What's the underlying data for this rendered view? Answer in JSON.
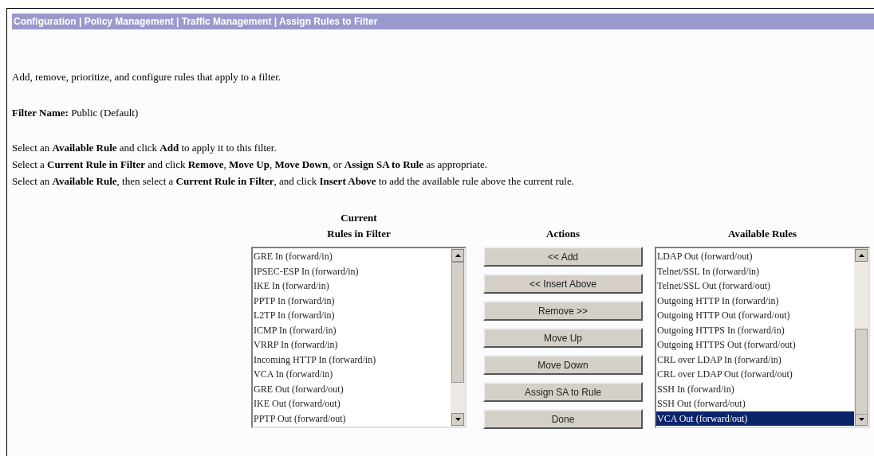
{
  "breadcrumb": "Configuration | Policy Management | Traffic Management | Assign Rules to Filter",
  "intro": "Add, remove, prioritize, and configure rules that apply to a filter.",
  "filter_name": {
    "label": "Filter Name:",
    "value": "Public (Default)"
  },
  "instructions": [
    "Select an **Available Rule** and click **Add** to apply it to this filter.",
    "Select a **Current Rule in Filter** and click **Remove**, **Move Up**, **Move Down**, or **Assign SA to Rule** as appropriate.",
    "Select an **Available Rule**, then select a **Current Rule in Filter**, and click **Insert Above** to add the available rule above the current rule."
  ],
  "current_rules": {
    "heading": [
      "Current",
      "Rules in Filter"
    ],
    "items": [
      {
        "label": "GRE In (forward/in)",
        "selected": false
      },
      {
        "label": "IPSEC-ESP In (forward/in)",
        "selected": false
      },
      {
        "label": "IKE In (forward/in)",
        "selected": false
      },
      {
        "label": "PPTP In (forward/in)",
        "selected": false
      },
      {
        "label": "L2TP In (forward/in)",
        "selected": false
      },
      {
        "label": "ICMP In (forward/in)",
        "selected": false
      },
      {
        "label": "VRRP In (forward/in)",
        "selected": false
      },
      {
        "label": "Incoming HTTP In (forward/in)",
        "selected": false
      },
      {
        "label": "VCA In (forward/in)",
        "selected": false
      },
      {
        "label": "GRE Out (forward/out)",
        "selected": false
      },
      {
        "label": "IKE Out (forward/out)",
        "selected": false
      },
      {
        "label": "PPTP Out (forward/out)",
        "selected": false
      }
    ]
  },
  "actions": {
    "heading": "Actions",
    "buttons": [
      "<< Add",
      "<< Insert Above",
      "Remove >>",
      "Move Up",
      "Move Down",
      "Assign SA to Rule",
      "Done"
    ]
  },
  "available_rules": {
    "heading": "Available Rules",
    "items": [
      {
        "label": "LDAP Out (forward/out)",
        "selected": false
      },
      {
        "label": "Telnet/SSL In (forward/in)",
        "selected": false
      },
      {
        "label": "Telnet/SSL Out (forward/out)",
        "selected": false
      },
      {
        "label": "Outgoing HTTP In (forward/in)",
        "selected": false
      },
      {
        "label": "Outgoing HTTP Out (forward/out)",
        "selected": false
      },
      {
        "label": "Outgoing HTTPS In (forward/in)",
        "selected": false
      },
      {
        "label": "Outgoing HTTPS Out (forward/out)",
        "selected": false
      },
      {
        "label": "CRL over LDAP In (forward/in)",
        "selected": false
      },
      {
        "label": "CRL over LDAP Out (forward/out)",
        "selected": false
      },
      {
        "label": "SSH In (forward/in)",
        "selected": false
      },
      {
        "label": "SSH Out (forward/out)",
        "selected": false
      },
      {
        "label": "VCA Out (forward/out)",
        "selected": true
      }
    ]
  }
}
